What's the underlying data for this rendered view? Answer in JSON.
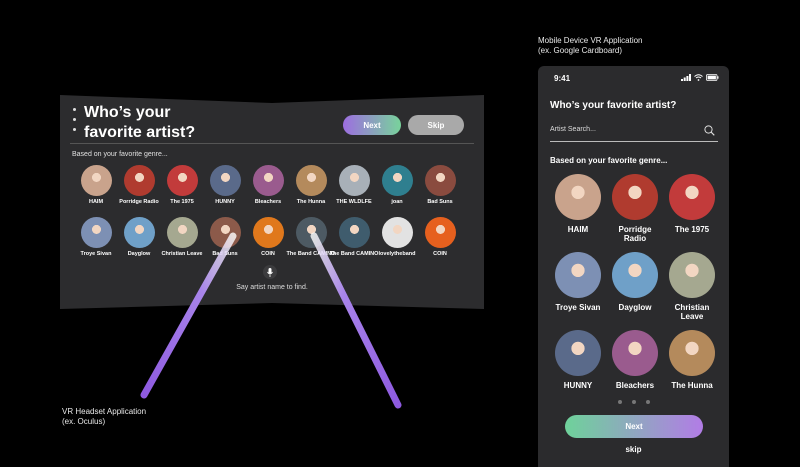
{
  "vr_caption": {
    "line1": "VR Headset Application",
    "line2": "(ex. Oculus)"
  },
  "mobile_caption": {
    "line1": "Mobile Device VR Application",
    "line2": "(ex. Google Cardboard)"
  },
  "vr": {
    "title_line1": "Who’s your",
    "title_line2": "favorite artist?",
    "next_label": "Next",
    "skip_label": "Skip",
    "subtitle": "Based on your favorite genre...",
    "artists": [
      {
        "name": "HAIM",
        "color": "#c9a38c"
      },
      {
        "name": "Porridge Radio",
        "color": "#b03b2f"
      },
      {
        "name": "The 1975",
        "color": "#c23b3b"
      },
      {
        "name": "HUNNY",
        "color": "#5a6a8a"
      },
      {
        "name": "Bleachers",
        "color": "#9a5b8e"
      },
      {
        "name": "The Hunna",
        "color": "#b48a5c"
      },
      {
        "name": "THE WLDLFE",
        "color": "#a8b0b8"
      },
      {
        "name": "joan",
        "color": "#2f7f8f"
      },
      {
        "name": "Bad Suns",
        "color": "#8a4b3f"
      },
      {
        "name": "Troye Sivan",
        "color": "#7d90b4"
      },
      {
        "name": "Dayglow",
        "color": "#6fa0c8"
      },
      {
        "name": "Christian Leave",
        "color": "#a5a890"
      },
      {
        "name": "Bad Suns",
        "color": "#8c5a4a"
      },
      {
        "name": "COIN",
        "color": "#e0781c"
      },
      {
        "name": "The Band CAMINO",
        "color": "#4d5a63"
      },
      {
        "name": "The Band CAMINO",
        "color": "#3f5c6d"
      },
      {
        "name": "lovelytheband",
        "color": "#e2e2e2"
      },
      {
        "name": "COIN",
        "color": "#e6601e"
      }
    ],
    "mic_hint": "Say artist name to find."
  },
  "phone": {
    "time": "9:41",
    "title": "Who’s your favorite artist?",
    "search_placeholder": "Artist Search...",
    "subtitle": "Based on your favorite genre...",
    "artists": [
      {
        "name": "HAIM",
        "color": "#c9a38c"
      },
      {
        "name": "Porridge Radio",
        "color": "#b03b2f"
      },
      {
        "name": "The 1975",
        "color": "#c23b3b"
      },
      {
        "name": "Troye Sivan",
        "color": "#7d90b4"
      },
      {
        "name": "Dayglow",
        "color": "#6fa0c8"
      },
      {
        "name": "Christian Leave",
        "color": "#a5a890"
      },
      {
        "name": "HUNNY",
        "color": "#5a6a8a"
      },
      {
        "name": "Bleachers",
        "color": "#9a5b8e"
      },
      {
        "name": "The Hunna",
        "color": "#b48a5c"
      }
    ],
    "next_label": "Next",
    "skip_label": "skip"
  }
}
